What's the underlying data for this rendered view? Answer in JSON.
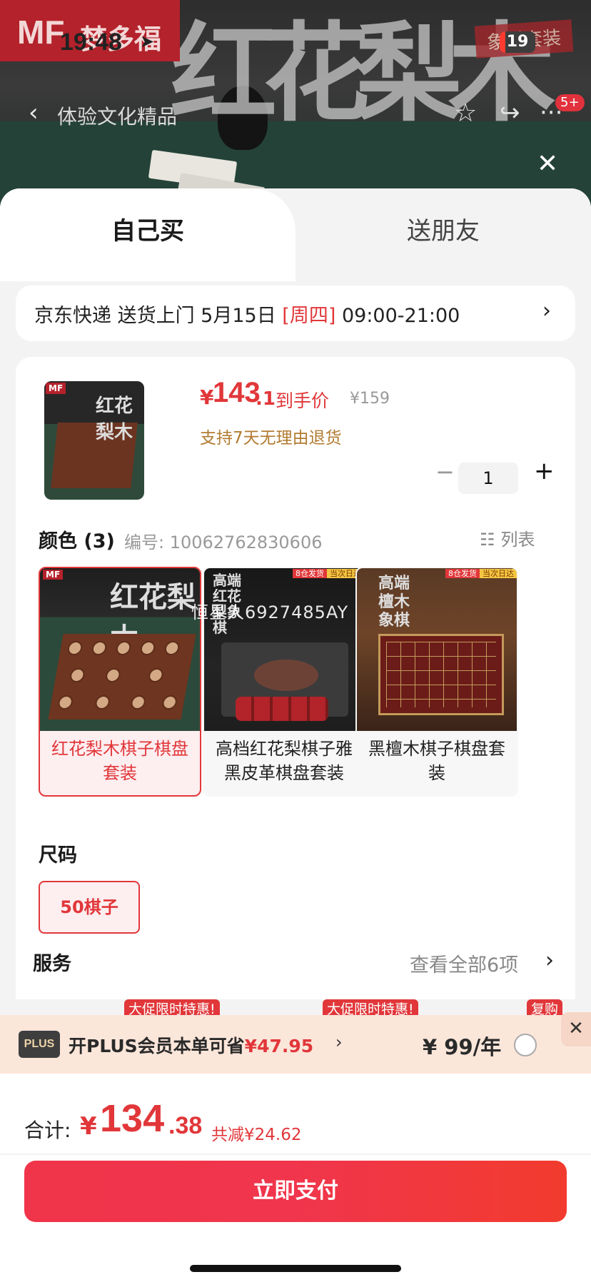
{
  "status": {
    "time": "19:48",
    "battery": "19"
  },
  "hero": {
    "brand_mark": "MF",
    "brand_name": "梦多福",
    "stamp": "象棋套装",
    "calligraphy": "红花梨木",
    "nav_title": "体验文化精品",
    "badge": "5+"
  },
  "tabs": {
    "self": "自己买",
    "friend": "送朋友"
  },
  "delivery": {
    "prefix": "京东快递 送货上门 5月15日 ",
    "weekday": "[周四]",
    "window": " 09:00-21:00"
  },
  "product": {
    "price_symbol": "¥",
    "price_int": "143",
    "price_dec": ".1",
    "price_label": "到手价",
    "original_price": "¥159",
    "return_policy": "支持7天无理由退货",
    "quantity": "1"
  },
  "color": {
    "label": "颜色 (3)",
    "sku": "编号: 10062762830606",
    "list_label": "列表",
    "options": [
      {
        "label": "红花梨木棋子棋盘套装",
        "selected": true
      },
      {
        "label": "高档红花梨棋子雅黑皮革棋盘套装",
        "selected": false
      },
      {
        "label": "黑檀木棋子棋盘套装",
        "selected": false
      }
    ],
    "ship_tag_a": "8仓发货",
    "ship_tag_b": "当次日达",
    "img_texts": [
      "红花梨木",
      "高端红花梨象棋",
      "高端檀木象棋"
    ]
  },
  "watermark": "恒星人6927485AY",
  "size": {
    "label": "尺码",
    "option": "50棋子"
  },
  "service": {
    "label": "服务",
    "view_all": "查看全部6项",
    "tags": [
      "大促限时特惠!",
      "大促限时特惠!",
      "复购"
    ]
  },
  "plus": {
    "logo": "PLUS",
    "text": "开PLUS会员本单可省",
    "save": "¥47.95",
    "price": "¥ 99/年"
  },
  "total": {
    "label": "合计:",
    "symbol": "¥",
    "int": "134",
    "dec": ".38",
    "saved": "共减¥24.62"
  },
  "pay_label": "立即支付",
  "colors": {
    "accent": "#e1373a",
    "plus_bg": "#fbe6da",
    "gold": "#b27b31"
  }
}
